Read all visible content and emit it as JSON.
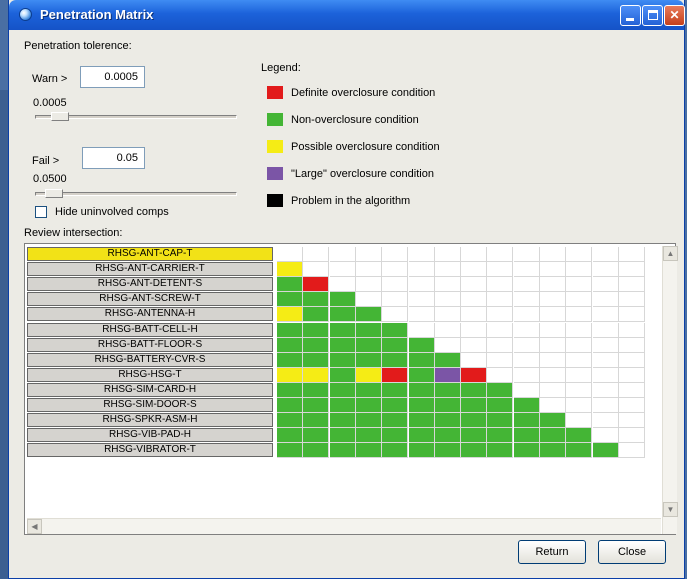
{
  "window": {
    "title": "Penetration Matrix"
  },
  "tolerance": {
    "section_label": "Penetration tolerence:",
    "warn": {
      "label": "Warn >",
      "value": "0.0005",
      "readout": "0.0005",
      "slider_level": 0.08
    },
    "fail": {
      "label": "Fail >",
      "value": "0.05",
      "readout": "0.0500",
      "slider_level": 0.05
    },
    "hide_label": "Hide uninvolved comps",
    "hide_checked": false
  },
  "legend": {
    "title": "Legend:",
    "items": [
      {
        "label": "Definite overclosure condition",
        "color": "#e21b1b"
      },
      {
        "label": "Non-overclosure condition",
        "color": "#44b535"
      },
      {
        "label": "Possible overclosure condition",
        "color": "#f5ec15"
      },
      {
        "label": "\"Large\" overclosure condition",
        "color": "#7b55a6"
      },
      {
        "label": "Problem in the algorithm",
        "color": "#000000"
      }
    ]
  },
  "review": {
    "label": "Review intersection:",
    "selected_row": 0,
    "columns": 14,
    "colors": {
      "R": "#e21b1b",
      "G": "#44b535",
      "Y": "#f5ec15",
      "P": "#7b55a6",
      "B": "#000000"
    },
    "rows": [
      {
        "name": "RHSG-ANT-CAP-T",
        "cells": ""
      },
      {
        "name": "RHSG-ANT-CARRIER-T",
        "cells": "Y"
      },
      {
        "name": "RHSG-ANT-DETENT-S",
        "cells": "GR"
      },
      {
        "name": "RHSG-ANT-SCREW-T",
        "cells": "GGG"
      },
      {
        "name": "RHSG-ANTENNA-H",
        "cells": "YGGG"
      },
      {
        "name": "RHSG-BATT-CELL-H",
        "cells": "GGGGG"
      },
      {
        "name": "RHSG-BATT-FLOOR-S",
        "cells": "GGGGGG"
      },
      {
        "name": "RHSG-BATTERY-CVR-S",
        "cells": "GGGGGGG"
      },
      {
        "name": "RHSG-HSG-T",
        "cells": "YYGYRGPR"
      },
      {
        "name": "RHSG-SIM-CARD-H",
        "cells": "GGGGGGGGG"
      },
      {
        "name": "RHSG-SIM-DOOR-S",
        "cells": "GGGGGGGGGG"
      },
      {
        "name": "RHSG-SPKR-ASM-H",
        "cells": "GGGGGGGGGGG"
      },
      {
        "name": "RHSG-VIB-PAD-H",
        "cells": "GGGGGGGGGGGG"
      },
      {
        "name": "RHSG-VIBRATOR-T",
        "cells": "GGGGGGGGGGGGG"
      }
    ]
  },
  "buttons": {
    "return": "Return",
    "close": "Close"
  }
}
